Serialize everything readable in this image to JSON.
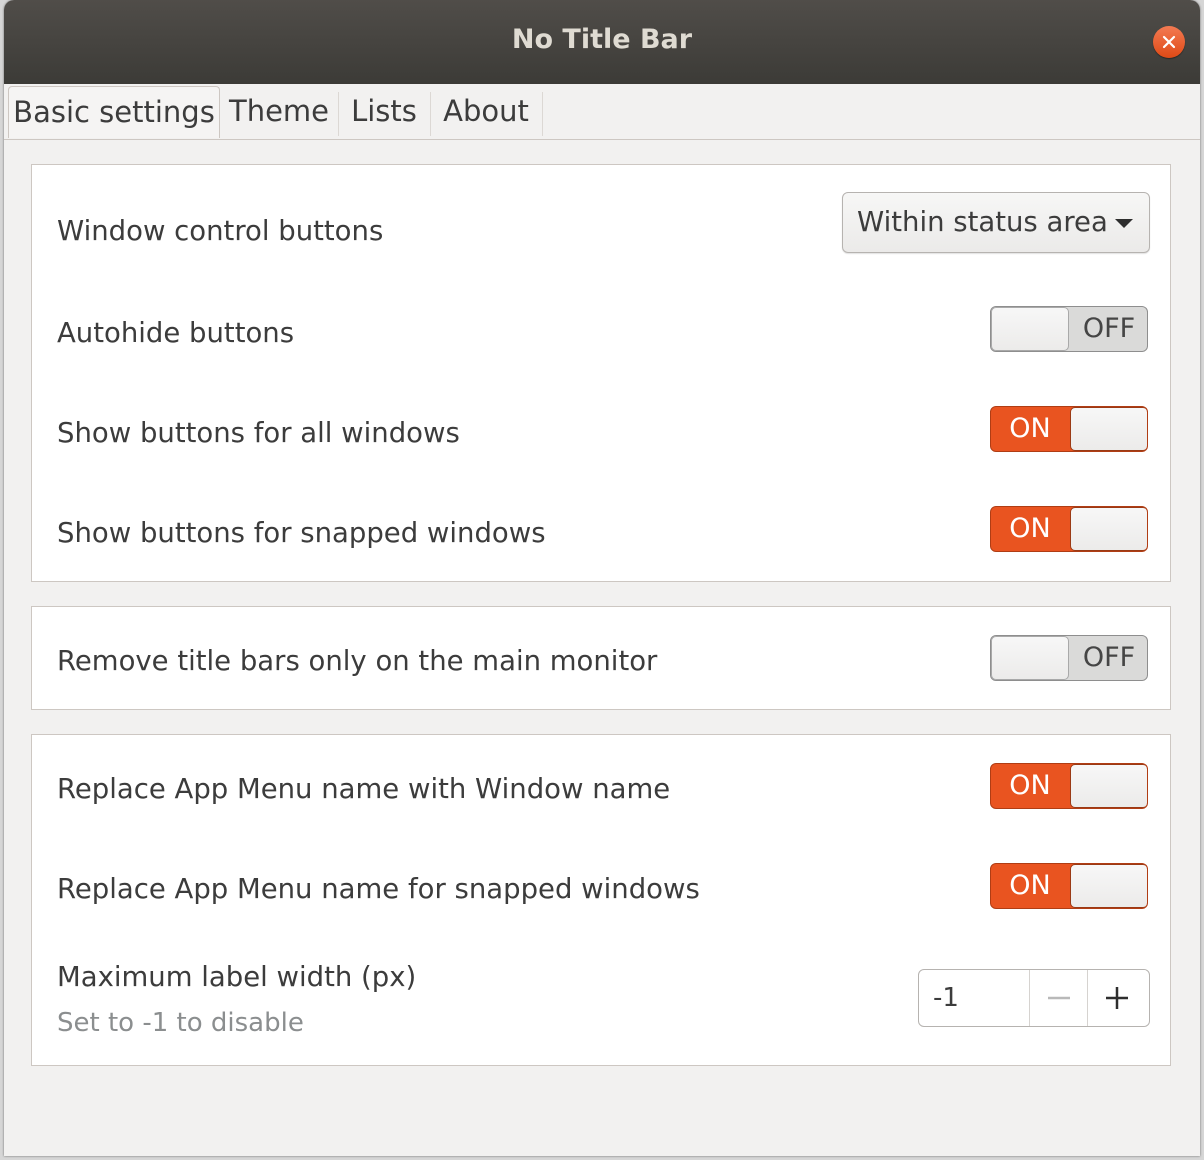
{
  "window": {
    "title": "No Title Bar"
  },
  "tabs": [
    {
      "label": "Basic settings",
      "active": true
    },
    {
      "label": "Theme",
      "active": false
    },
    {
      "label": "Lists",
      "active": false
    },
    {
      "label": "About",
      "active": false
    }
  ],
  "section1": {
    "window_control": {
      "label": "Window control buttons",
      "selected": "Within status area"
    },
    "autohide": {
      "label": "Autohide buttons",
      "state": "OFF"
    },
    "all_windows": {
      "label": "Show buttons for all windows",
      "state": "ON"
    },
    "snapped_windows": {
      "label": "Show buttons for snapped windows",
      "state": "ON"
    }
  },
  "section2": {
    "main_monitor": {
      "label": "Remove title bars only on the main monitor",
      "state": "OFF"
    }
  },
  "section3": {
    "replace_window_name": {
      "label": "Replace App Menu name with Window name",
      "state": "ON"
    },
    "replace_snapped": {
      "label": "Replace App Menu name for snapped windows",
      "state": "ON"
    },
    "max_label_width": {
      "label": "Maximum label width (px)",
      "hint": "Set to -1 to disable",
      "value": "-1"
    }
  },
  "colors": {
    "accent": "#e95420",
    "titlebar": "#3c3b37"
  }
}
